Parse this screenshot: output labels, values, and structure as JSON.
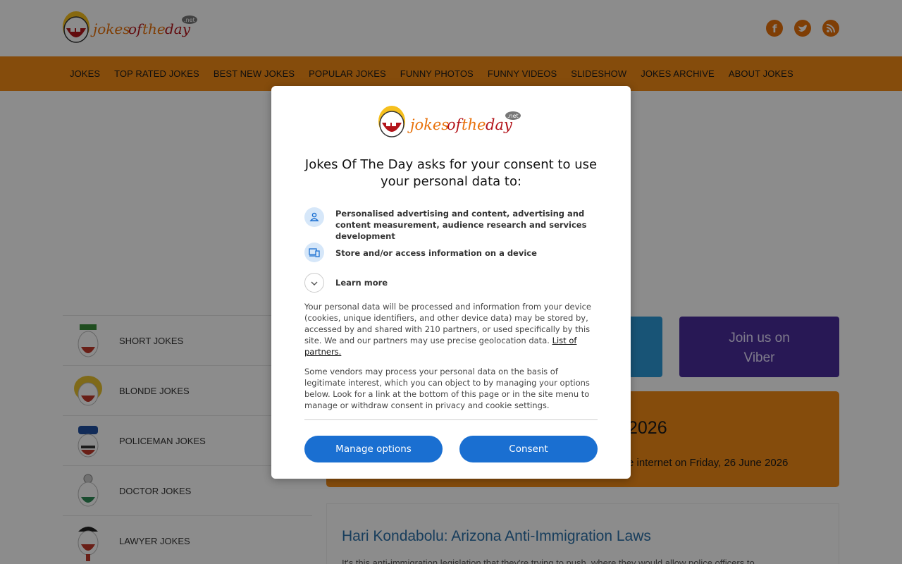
{
  "header": {
    "logo_alt": "jokesoftheday.net",
    "social": [
      {
        "name": "facebook-icon"
      },
      {
        "name": "twitter-icon"
      },
      {
        "name": "rss-icon"
      }
    ]
  },
  "nav": {
    "items": [
      {
        "label": "JOKES"
      },
      {
        "label": "TOP RATED JOKES"
      },
      {
        "label": "BEST NEW JOKES"
      },
      {
        "label": "POPULAR JOKES"
      },
      {
        "label": "FUNNY PHOTOS"
      },
      {
        "label": "FUNNY VIDEOS"
      },
      {
        "label": "SLIDESHOW"
      },
      {
        "label": "JOKES ARCHIVE"
      },
      {
        "label": "ABOUT JOKES"
      }
    ]
  },
  "sidebar": {
    "categories": [
      {
        "label": "SHORT JOKES"
      },
      {
        "label": "BLONDE JOKES"
      },
      {
        "label": "POLICEMAN JOKES"
      },
      {
        "label": "DOCTOR JOKES"
      },
      {
        "label": "LAWYER JOKES"
      }
    ]
  },
  "buttons": {
    "viber_line1": "Join us on",
    "viber_line2": "Viber"
  },
  "jotd": {
    "title_fragment": "2026",
    "subtitle_fragment": "e internet on Friday, 26 June 2026"
  },
  "article": {
    "title": "Hari Kondabolu: Arizona Anti-Immigration Laws",
    "snippet": "It's this anti-immigration legislation that they're trying to push, where they would allow police officers to"
  },
  "consent": {
    "title": "Jokes Of The Day asks for your consent to use your personal data to:",
    "purposes": [
      {
        "text": "Personalised advertising and content, advertising and content measurement, audience research and services development",
        "icon": "person-icon"
      },
      {
        "text": "Store and/or access information on a device",
        "icon": "devices-icon"
      }
    ],
    "learn_more": "Learn more",
    "para1": "Your personal data will be processed and information from your device (cookies, unique identifiers, and other device data) may be stored by, accessed by and shared with 210 partners, or used specifically by this site. We and our partners may use precise geolocation data.",
    "partners_link": "List of partners.",
    "para2": "Some vendors may process your personal data on the basis of legitimate interest, which you can object to by managing your options below. Look for a link at the bottom of this page or in the site menu to manage or withdraw consent in privacy and cookie settings.",
    "manage_label": "Manage options",
    "consent_label": "Consent"
  },
  "colors": {
    "brand_orange": "#f28a17",
    "accent_blue": "#1a6fd1",
    "viber_purple": "#4a2d9c",
    "telegram_blue": "#2d9ad8"
  }
}
